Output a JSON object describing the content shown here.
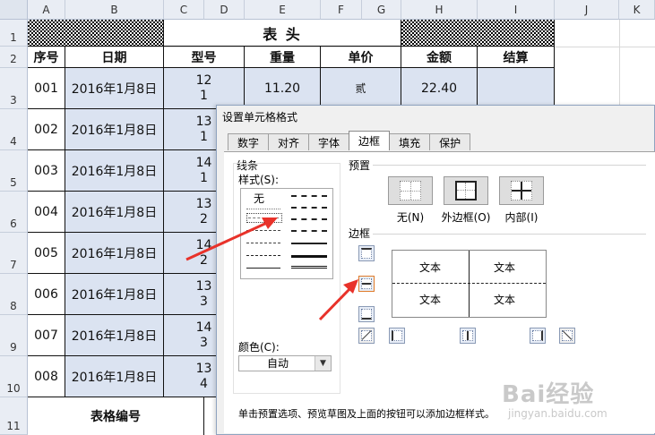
{
  "columns": [
    "A",
    "B",
    "C",
    "D",
    "E",
    "F",
    "G",
    "H",
    "I",
    "J",
    "K"
  ],
  "rows": [
    "1",
    "2",
    "3",
    "4",
    "5",
    "6",
    "7",
    "8",
    "9",
    "10",
    "11"
  ],
  "sheet": {
    "title": "表  头",
    "headers": {
      "seq": "序号",
      "date": "日期",
      "model": "型号",
      "weight": "重量",
      "unit_price": "单价",
      "amount": "金额",
      "settle": "结算"
    },
    "data_rows": [
      {
        "seq": "001",
        "date": "2016年1月8日",
        "model_a": "12",
        "model_b": "1",
        "weight": "11.20",
        "unit_price": "贰",
        "amount": "22.40"
      },
      {
        "seq": "002",
        "date": "2016年1月8日",
        "model_a": "13",
        "model_b": "1"
      },
      {
        "seq": "003",
        "date": "2016年1月8日",
        "model_a": "14",
        "model_b": "1"
      },
      {
        "seq": "004",
        "date": "2016年1月8日",
        "model_a": "13",
        "model_b": "2"
      },
      {
        "seq": "005",
        "date": "2016年1月8日",
        "model_a": "14",
        "model_b": "2"
      },
      {
        "seq": "006",
        "date": "2016年1月8日",
        "model_a": "13",
        "model_b": "3"
      },
      {
        "seq": "007",
        "date": "2016年1月8日",
        "model_a": "14",
        "model_b": "3"
      },
      {
        "seq": "008",
        "date": "2016年1月8日",
        "model_a": "13",
        "model_b": "4"
      }
    ],
    "footer_label": "表格编号"
  },
  "dialog": {
    "title": "设置单元格格式",
    "tabs": [
      "数字",
      "对齐",
      "字体",
      "边框",
      "填充",
      "保护"
    ],
    "active_tab": "边框",
    "line_group": "线条",
    "style_label": "样式(S):",
    "style_none": "无",
    "color_label": "颜色(C):",
    "color_value": "自动",
    "preset_group": "预置",
    "presets": [
      "无(N)",
      "外边框(O)",
      "内部(I)"
    ],
    "border_group": "边框",
    "preview_text": [
      "文本",
      "文本",
      "文本",
      "文本"
    ],
    "hint": "单击预置选项、预览草图及上面的按钮可以添加边框样式。"
  },
  "watermark": {
    "brand": "Bai经验",
    "url": "jingyan.baidu.com"
  },
  "colors": {
    "header_blue": "#dbe3f1",
    "arrow_red": "#e8322a",
    "dialog_bg": "#f0f0f0"
  }
}
